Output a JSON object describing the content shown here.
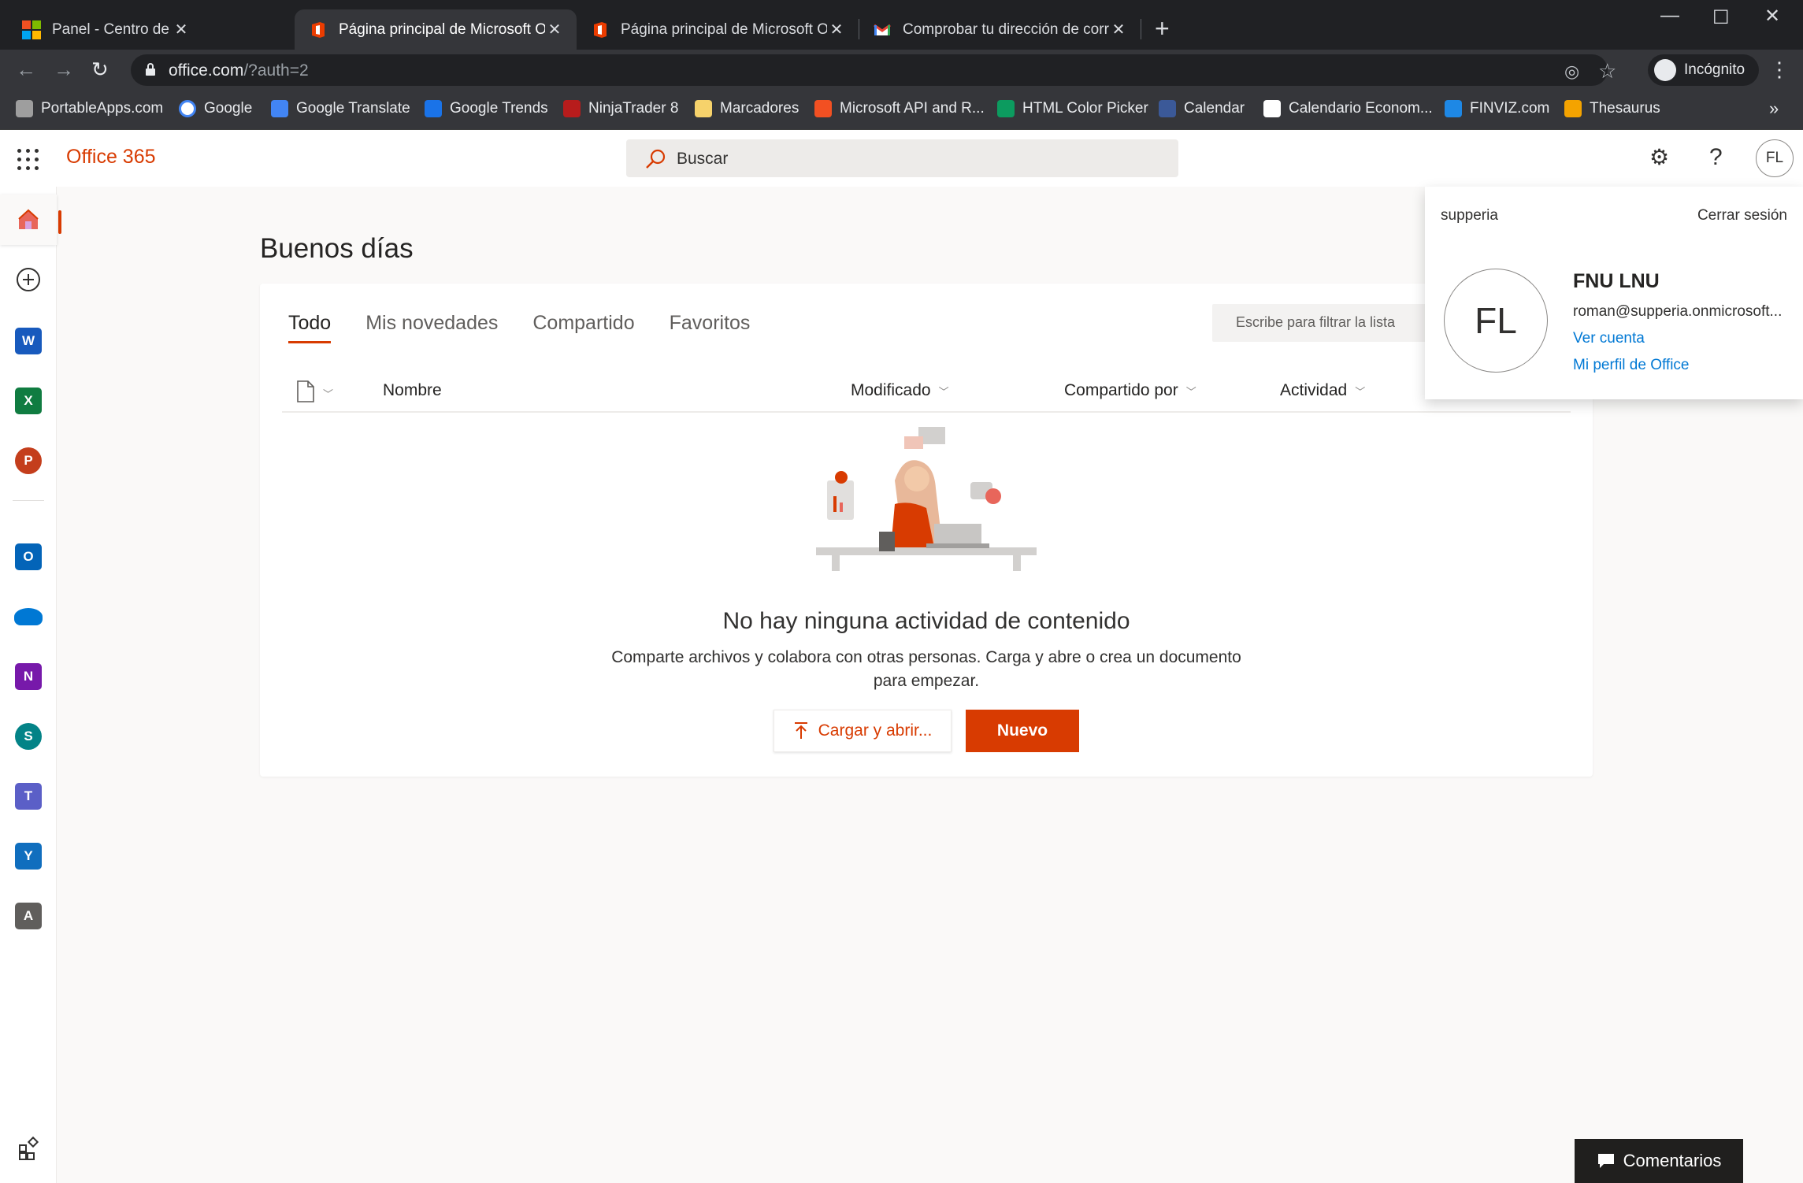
{
  "browser": {
    "tabs": [
      {
        "title": "Panel - Centro de desarrollo de M",
        "favicon": "microsoft-logo-icon",
        "active": false
      },
      {
        "title": "Página principal de Microsoft Offi",
        "favicon": "office-logo-icon",
        "active": true
      },
      {
        "title": "Página principal de Microsoft Offi",
        "favicon": "office-logo-icon",
        "active": false
      },
      {
        "title": "Comprobar tu dirección de corre",
        "favicon": "gmail-icon",
        "active": false
      }
    ],
    "new_tab": "+",
    "url_host": "office.com",
    "url_rest": "/?auth=2",
    "incognito_label": "Incógnito",
    "bookmarks": [
      {
        "label": "PortableApps.com",
        "color": "#9e9e9e"
      },
      {
        "label": "Google",
        "color": "#4285f4"
      },
      {
        "label": "Google Translate",
        "color": "#4285f4"
      },
      {
        "label": "Google Trends",
        "color": "#1a73e8"
      },
      {
        "label": "NinjaTrader 8",
        "color": "#b71c1c"
      },
      {
        "label": "Marcadores",
        "color": "#f6d26b"
      },
      {
        "label": "Microsoft API and R...",
        "color": "#f25022"
      },
      {
        "label": "HTML Color Picker",
        "color": "#0c9b5f"
      },
      {
        "label": "Calendar",
        "color": "#3b5998"
      },
      {
        "label": "Calendario Econom...",
        "color": "#ffffff"
      },
      {
        "label": "FINVIZ.com",
        "color": "#1e88e5"
      },
      {
        "label": "Thesaurus",
        "color": "#f4a300"
      }
    ],
    "bookmarks_more": "»"
  },
  "office": {
    "brand": "Office 365",
    "search_placeholder": "Buscar",
    "avatar_initials": "FL"
  },
  "rail": [
    {
      "name": "home",
      "label": "",
      "color": "#d83b01"
    },
    {
      "name": "create",
      "label": "",
      "color": "#323130"
    },
    {
      "name": "word",
      "label": "W",
      "color": "#185abd"
    },
    {
      "name": "excel",
      "label": "X",
      "color": "#107c41"
    },
    {
      "name": "powerpoint",
      "label": "P",
      "color": "#c43e1c"
    },
    {
      "name": "outlook",
      "label": "O",
      "color": "#0364b8"
    },
    {
      "name": "onedrive",
      "label": "",
      "color": "#0078d4"
    },
    {
      "name": "onenote",
      "label": "N",
      "color": "#7719aa"
    },
    {
      "name": "sharepoint",
      "label": "S",
      "color": "#038387"
    },
    {
      "name": "teams",
      "label": "T",
      "color": "#5b5fc7"
    },
    {
      "name": "yammer",
      "label": "Y",
      "color": "#106ebe"
    },
    {
      "name": "admin",
      "label": "A",
      "color": "#605e5c"
    }
  ],
  "main": {
    "greeting": "Buenos días",
    "tabs": [
      "Todo",
      "Mis novedades",
      "Compartido",
      "Favoritos"
    ],
    "filter_placeholder": "Escribe para filtrar la lista",
    "columns": {
      "name": "Nombre",
      "modified": "Modificado",
      "shared_by": "Compartido por",
      "activity": "Actividad"
    },
    "empty_title": "No hay ninguna actividad de contenido",
    "empty_desc": "Comparte archivos y colabora con otras personas. Carga y abre o crea un documento para empezar.",
    "upload_label": "Cargar y abrir...",
    "new_label": "Nuevo"
  },
  "account": {
    "tenant": "supperia",
    "sign_out": "Cerrar sesión",
    "initials": "FL",
    "name": "FNU LNU",
    "email": "roman@supperia.onmicrosoft...",
    "view_account": "Ver cuenta",
    "office_profile": "Mi perfil de Office"
  },
  "feedback_label": "Comentarios",
  "colors": {
    "accent": "#d83b01",
    "link": "#0078d4"
  }
}
